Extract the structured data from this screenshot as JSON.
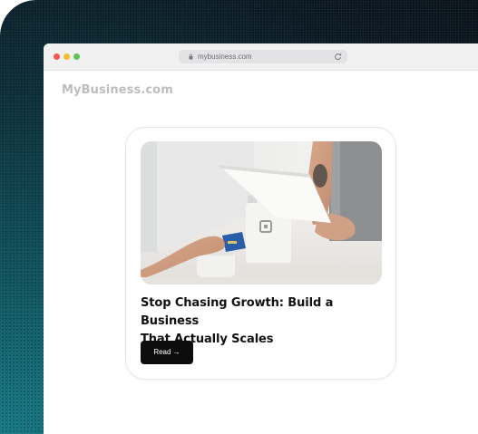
{
  "browser": {
    "url": "mybusiness.com",
    "lock_icon": "lock-icon",
    "reload_icon": "reload-icon"
  },
  "site": {
    "brand": "MyBusiness.com"
  },
  "article": {
    "title_line1": "Stop Chasing Growth: Build a Business",
    "title_line2": "That Actually Scales",
    "read_label": "Read →"
  },
  "colors": {
    "button_bg": "#0d0d0d",
    "brand_text": "#bdbdbf",
    "backdrop_teal": "#167a86",
    "backdrop_dark": "#0a131b"
  }
}
